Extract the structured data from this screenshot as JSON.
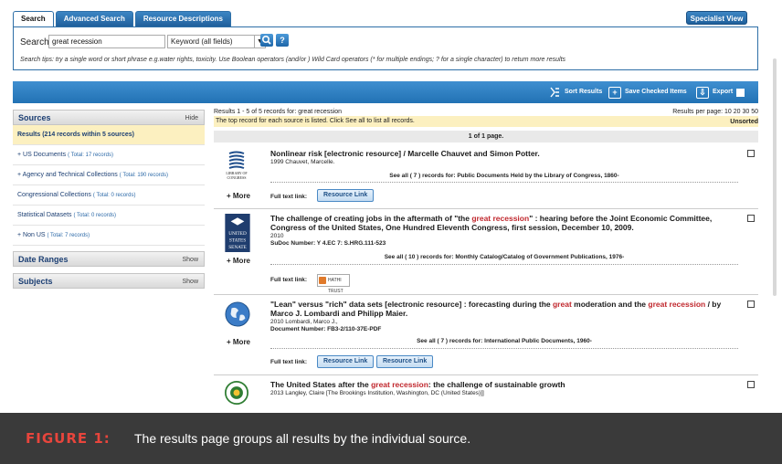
{
  "tabs": [
    {
      "label": "Search"
    },
    {
      "label": "Advanced Search"
    },
    {
      "label": "Resource Descriptions"
    }
  ],
  "specialist_label": "Specialist View",
  "search": {
    "label": "Search",
    "value": "great recession",
    "field": "Keyword (all fields)",
    "tips": "Search tips: try a single word or short phrase e.g.water rights, toxicity. Use Boolean operators (and/or ) Wild Card operators (* for multiple endings; ? for a single character) to return more results"
  },
  "toolbar": {
    "sort": "Sort Results",
    "save": "Save Checked Items",
    "export": "Export"
  },
  "sidebar": {
    "sources_title": "Sources",
    "sources_action": "Hide",
    "results_summary": "Results (214 records within 5 sources)",
    "items": [
      {
        "label": "+ US Documents",
        "total": "( Total: 17 records)"
      },
      {
        "label": "+ Agency and Technical Collections",
        "total": "( Total: 190 records)"
      },
      {
        "label": "Congressional Collections",
        "total": "( Total: 0 records)"
      },
      {
        "label": "Statistical Datasets",
        "total": "( Total: 0 records)"
      },
      {
        "label": "+ Non US",
        "total": "( Total: 7 records)"
      }
    ],
    "date_ranges": "Date Ranges",
    "subjects": "Subjects",
    "show": "Show"
  },
  "results": {
    "count": "Results 1 - 5 of 5 records for: great recession",
    "per_page": "Results per page: 10  20  30  50",
    "note": "The top record for each source is listed. Click See all to list all records.",
    "sort": "Unsorted",
    "page": "1 of 1 page.",
    "more": "+ More",
    "full_text": "Full text link:",
    "resource_link": "Resource Link",
    "records": [
      {
        "title": "Nonlinear risk [electronic resource] / Marcelle Chauvet and Simon Potter.",
        "meta1": "1999 Chauvet, Marcelle.",
        "see_all": "See all ( 7 ) records for:   Public Documents Held by the Library of Congress, 1860-",
        "thumb": "library-of-congress-logo"
      },
      {
        "title_a": "The challenge of creating jobs in the aftermath of \"the ",
        "title_hl": "great recession",
        "title_b": "\" : hearing before the Joint Economic Committee, Congress of the United States, One Hundred Eleventh Congress, first session, December 10, 2009.",
        "meta1": "2010",
        "meta2": "SuDoc Number: Y 4.EC 7: S.HRG.111-523",
        "see_all": "See all ( 10 ) records for:   Monthly Catalog/Catalog of Government Publications, 1976-",
        "hathi": "HATHI TRUST",
        "thumb": "us-senate-logo"
      },
      {
        "title_a": "\"Lean\" versus \"rich\" data sets [electronic resource] : forecasting during the ",
        "title_hl1": "great",
        "title_b": " moderation and the ",
        "title_hl2": "great recession",
        "title_c": " / by Marco J. Lombardi and Philipp Maier.",
        "meta1": "2010 Lombardi, Marco J.,",
        "meta2": "Document Number: FB3-2/110-37E-PDF",
        "see_all": "See all ( 7 ) records for:   International Public Documents, 1960-",
        "thumb": "globe-icon"
      },
      {
        "title_a": "The United States after the ",
        "title_hl": "great recession",
        "title_b": ": the challenge of sustainable growth",
        "meta1": "2013 Langley, Claire [The Brookings Institution, Washington, DC (United States)]]",
        "thumb": "department-of-energy-seal"
      }
    ]
  },
  "caption": {
    "label": "FIGURE 1:",
    "text": "The results page groups all results by the individual source."
  },
  "colors": {
    "accent_blue": "#2272b4",
    "highlight_red": "#c0272d",
    "note_yellow": "#fcf0c0",
    "caption_bg": "#3a3a3a",
    "caption_label": "#e8453c"
  }
}
